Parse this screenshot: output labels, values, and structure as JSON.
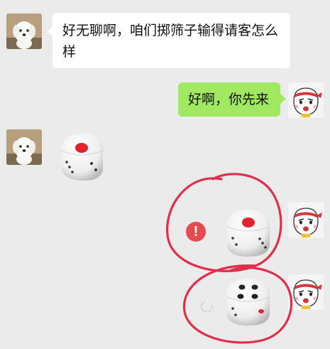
{
  "chat": {
    "messages": [
      {
        "sender": "friend",
        "type": "text",
        "text": "好无聊啊，咱们掷筛子输得请客怎么样"
      },
      {
        "sender": "me",
        "type": "text",
        "text": "好啊，你先来"
      },
      {
        "sender": "friend",
        "type": "dice",
        "value": 1
      },
      {
        "sender": "me",
        "type": "dice",
        "value": 1,
        "status": "failed"
      },
      {
        "sender": "me",
        "type": "dice",
        "value": 4,
        "status": "sending"
      }
    ],
    "error_mark": "!"
  },
  "colors": {
    "background": "#ebebeb",
    "friend_bubble": "#ffffff",
    "my_bubble": "#9fe85f",
    "error": "#e84a52",
    "annotation": "#e02e4c"
  }
}
